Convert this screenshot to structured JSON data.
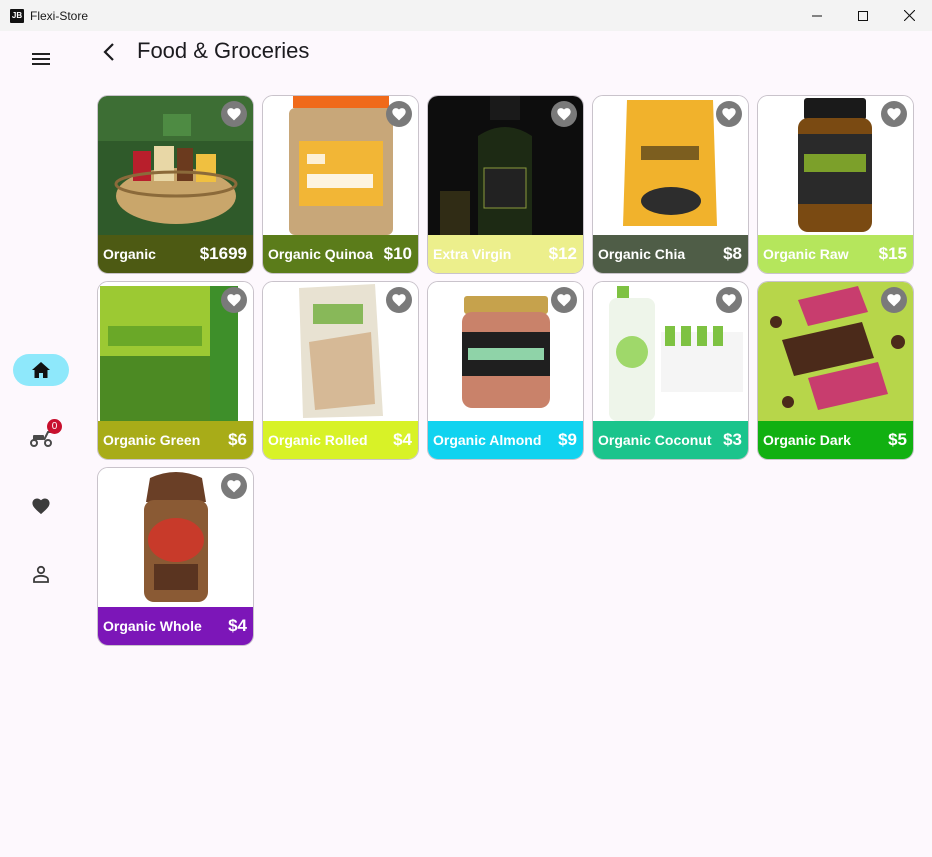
{
  "window": {
    "title": "Flexi-Store",
    "icon_text": "JB"
  },
  "page": {
    "title": "Food & Groceries"
  },
  "nav": {
    "cart_badge": "0"
  },
  "products": [
    {
      "name": "Organic",
      "price": "$1699",
      "bar_color": "#4d5a13"
    },
    {
      "name": "Organic Quinoa",
      "price": "$10",
      "bar_color": "#5b7c1a"
    },
    {
      "name": "Extra Virgin",
      "price": "$12",
      "bar_color": "#ecef8c"
    },
    {
      "name": "Organic Chia",
      "price": "$8",
      "bar_color": "#4f5d47"
    },
    {
      "name": "Organic Raw",
      "price": "$15",
      "bar_color": "#b5e65c"
    },
    {
      "name": "Organic Green",
      "price": "$6",
      "bar_color": "#a8ac18"
    },
    {
      "name": "Organic Rolled",
      "price": "$4",
      "bar_color": "#d8f227"
    },
    {
      "name": "Organic Almond",
      "price": "$9",
      "bar_color": "#10d3f0"
    },
    {
      "name": "Organic Coconut",
      "price": "$3",
      "bar_color": "#1bc48c"
    },
    {
      "name": "Organic Dark",
      "price": "$5",
      "bar_color": "#11b011"
    },
    {
      "name": "Organic Whole",
      "price": "$4",
      "bar_color": "#7c16b8"
    }
  ]
}
